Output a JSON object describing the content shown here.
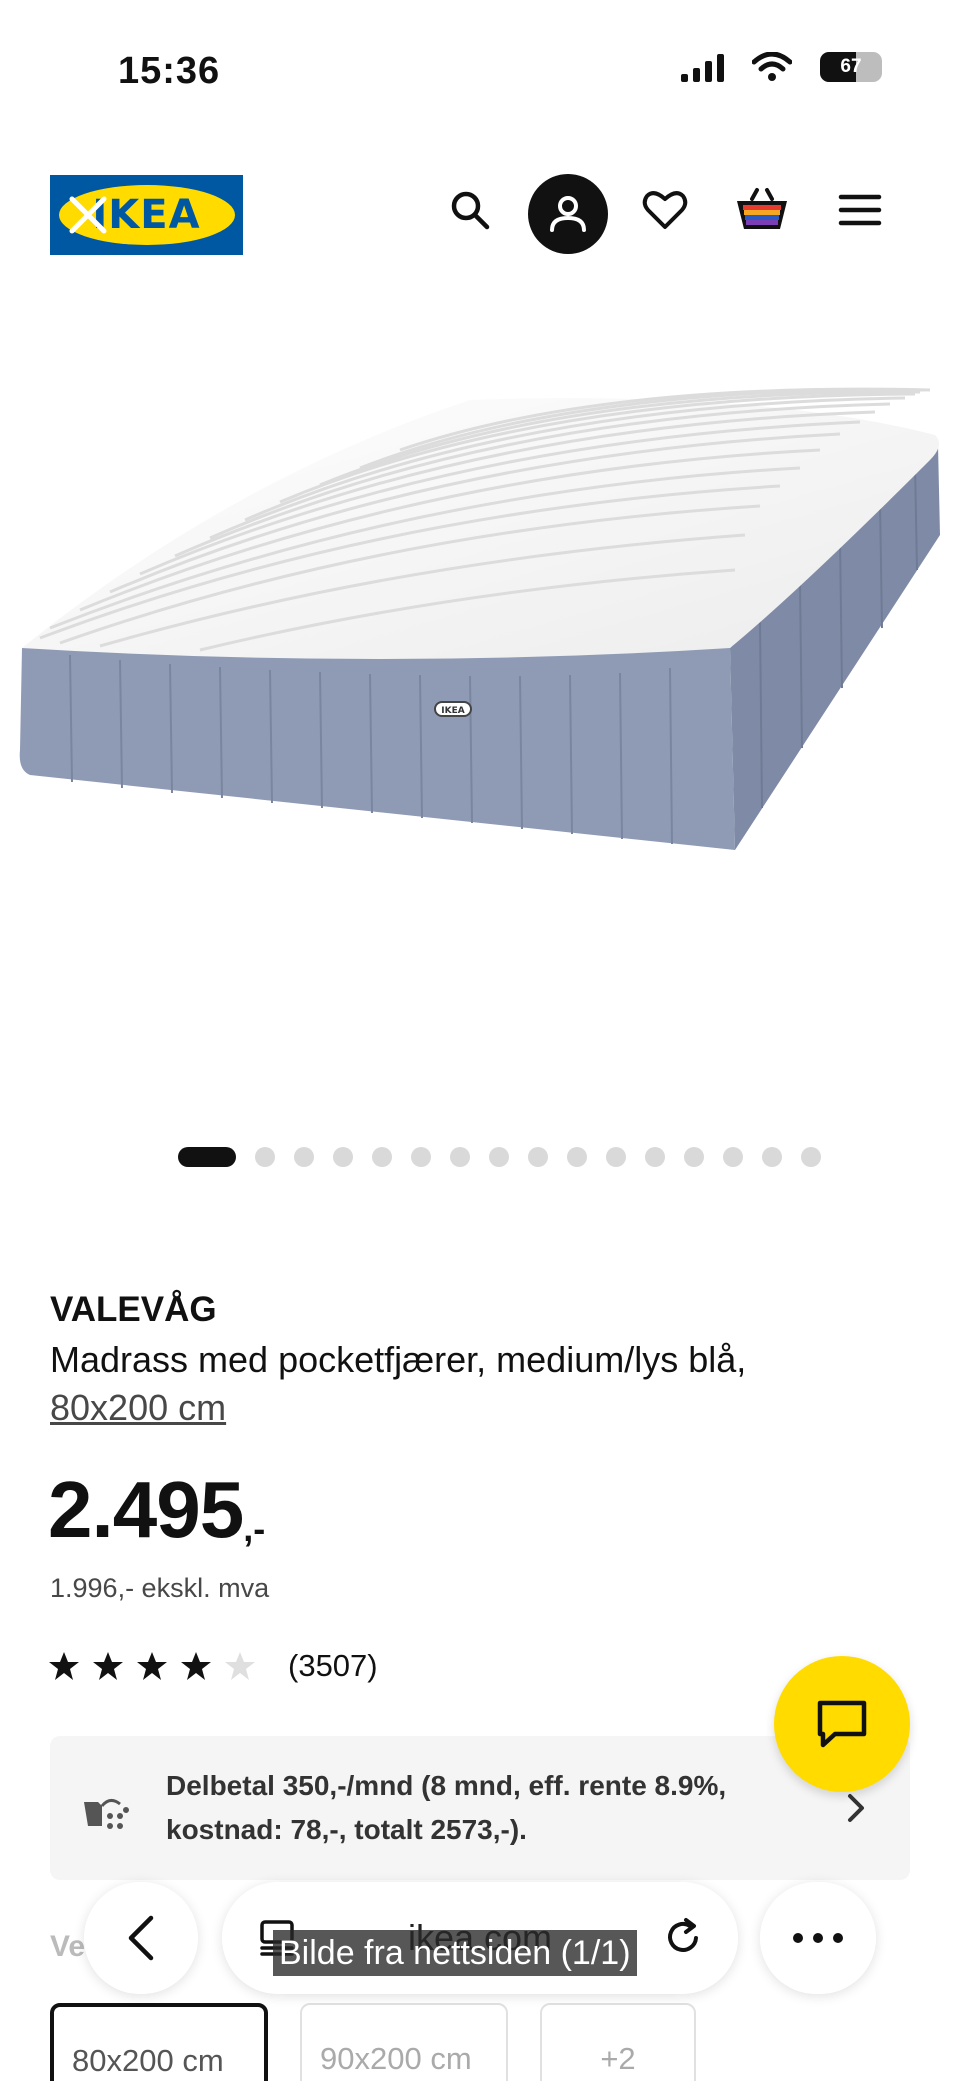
{
  "status_bar": {
    "time": "15:36",
    "battery": "67"
  },
  "header": {
    "logo_text": "IKEA",
    "icons": [
      "close-icon",
      "search-icon",
      "account-icon",
      "heart-icon",
      "basket-icon",
      "menu-icon"
    ],
    "colors": {
      "logo_blue": "#0058a3",
      "logo_yellow": "#ffdb00"
    }
  },
  "carousel": {
    "total_images": 16,
    "active_index": 0
  },
  "product": {
    "name": "VALEVÅG",
    "description": "Madrass med pocketfjærer, medium/lys blå,",
    "size_link": "80x200 cm",
    "price_main": "2.495",
    "price_suffix": ",-",
    "price_ex_vat": "1.996,- ekskl. mva",
    "rating": {
      "stars": 4,
      "max": 5,
      "count": "(3507)"
    }
  },
  "financing": {
    "text": "Delbetal 350,-/mnd (8 mnd, eff. rente 8.9%, kostnad: 78,-, totalt 2573,-)."
  },
  "variants": {
    "label_partial": "Ve",
    "options": [
      "80x200 cm",
      "90x200 cm",
      "+2"
    ],
    "selected": "80x200 cm"
  },
  "browser": {
    "domain": "ikea.com",
    "caption": "Bilde fra nettsiden (1/1)"
  },
  "colors": {
    "chat_fab": "#ffdb00",
    "finance_bg": "#f5f5f5"
  }
}
